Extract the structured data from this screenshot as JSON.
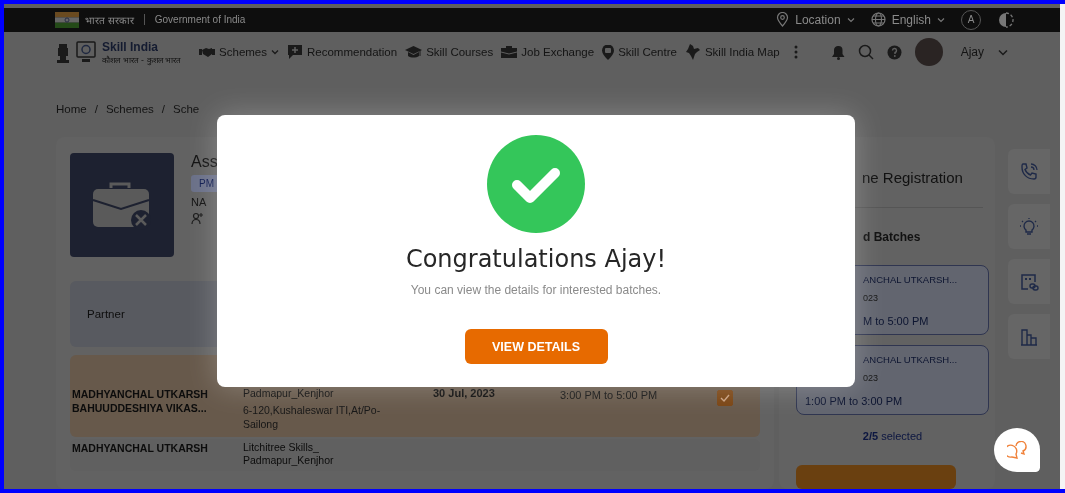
{
  "gov_bar": {
    "hindi_label": "भारत सरकार",
    "title": "Government of India",
    "location": "Location",
    "language": "English",
    "text_size_button": "A"
  },
  "nav": {
    "brand": "Skill India",
    "brand_tagline": "कौशल भारत - कुशल भारत",
    "items": [
      {
        "label": "Schemes",
        "has_menu": true
      },
      {
        "label": "Recommendation",
        "has_menu": false
      },
      {
        "label": "Skill Courses",
        "has_menu": false
      },
      {
        "label": "Job Exchange",
        "has_menu": false
      },
      {
        "label": "Skill Centre",
        "has_menu": false
      },
      {
        "label": "Skill India Map",
        "has_menu": false
      }
    ],
    "user_name": "Ajay"
  },
  "breadcrumb": {
    "separator": "/",
    "items": [
      "Home",
      "Schemes",
      "Sche"
    ]
  },
  "scheme": {
    "title": "Ass",
    "tag": "PM",
    "location": "NA"
  },
  "table": {
    "columns": [
      "Partner"
    ],
    "rows": [
      {
        "partner": "MADHYANCHAL UTKARSH BAHUUDDESHIYA VIKAS...",
        "centre": "Padmapur_Kenjhor",
        "address": "6-120,Kushaleswar ITI,At/Po-Sailong",
        "date": "30 Jul, 2023",
        "time": "3:00 PM to 5:00 PM",
        "checked": true
      },
      {
        "partner": "MADHYANCHAL UTKARSH",
        "centre": "Litchitree Skills_ Padmapur_Kenjhor"
      }
    ]
  },
  "registration": {
    "title": "ne Registration",
    "batches_heading": "d Batches",
    "batches": [
      {
        "partner": "ANCHAL UTKARSH...",
        "date": "023",
        "time": "M to 5:00 PM"
      },
      {
        "partner": "ANCHAL UTKARSH...",
        "date": "023",
        "time": "1:00 PM to 3:00 PM"
      }
    ],
    "selected_text": "**2/5** selected"
  },
  "modal": {
    "title": "Congratulations Ajay!",
    "message": "You can view the details for interested batches.",
    "button": "VIEW DETAILS"
  }
}
